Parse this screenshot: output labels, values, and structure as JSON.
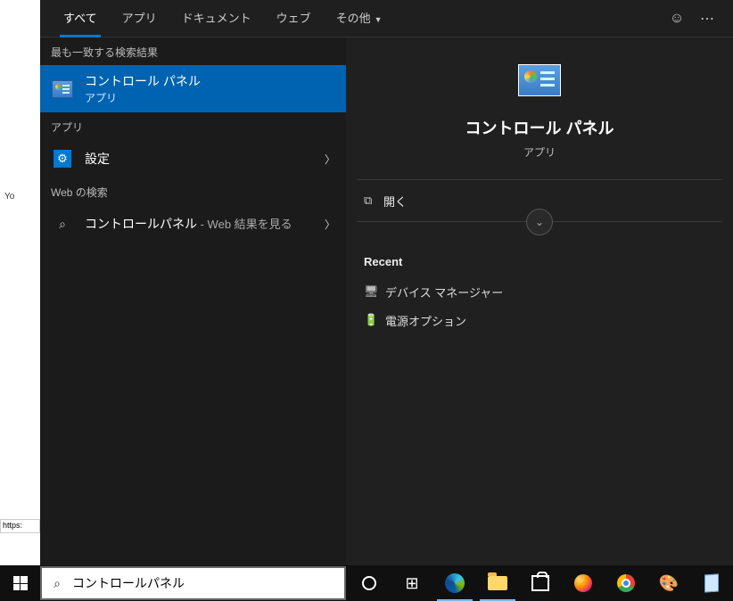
{
  "tabs": {
    "all": "すべて",
    "apps": "アプリ",
    "documents": "ドキュメント",
    "web": "ウェブ",
    "more": "その他"
  },
  "left": {
    "best_match_header": "最も一致する検索結果",
    "best_match": {
      "title": "コントロール パネル",
      "subtitle": "アプリ"
    },
    "apps_header": "アプリ",
    "settings_label": "設定",
    "web_header": "Web の検索",
    "web_query": "コントロールパネル",
    "web_suffix": " - Web 結果を見る"
  },
  "preview": {
    "title": "コントロール パネル",
    "subtitle": "アプリ",
    "open_label": "開く",
    "recent_header": "Recent",
    "recent": [
      {
        "label": "デバイス マネージャー"
      },
      {
        "label": "電源オプション"
      }
    ]
  },
  "search": {
    "value": "コントロールパネル"
  },
  "desktop": {
    "url_fragment": "https:"
  }
}
